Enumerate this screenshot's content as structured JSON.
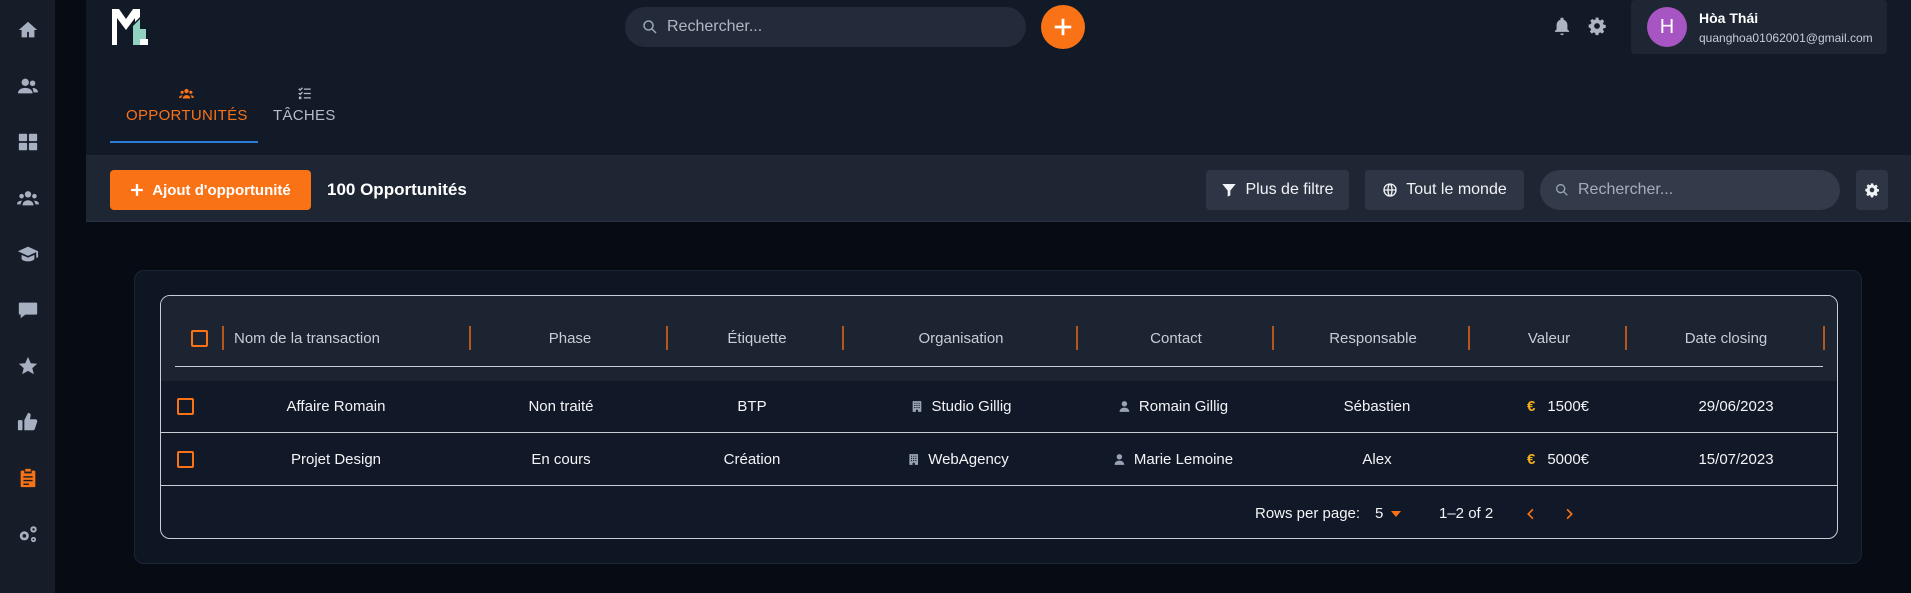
{
  "sidebar": {
    "items": [
      {
        "icon": "home-icon"
      },
      {
        "icon": "contacts-icon"
      },
      {
        "icon": "dashboard-icon"
      },
      {
        "icon": "team-icon"
      },
      {
        "icon": "graduation-cap-icon"
      },
      {
        "icon": "chat-icon"
      },
      {
        "icon": "star-icon"
      },
      {
        "icon": "thumbs-up-icon"
      },
      {
        "icon": "clipboard-icon",
        "active": true
      },
      {
        "icon": "cogs-icon"
      }
    ]
  },
  "header": {
    "search_placeholder": "Rechercher...",
    "user": {
      "initial": "H",
      "name": "Hòa Thái",
      "email": "quanghoa01062001@gmail.com"
    }
  },
  "tabs": [
    {
      "label": "OPPORTUNITÉS",
      "icon": "users-icon",
      "active": true
    },
    {
      "label": "TÂCHES",
      "icon": "checklist-icon",
      "active": false
    }
  ],
  "toolbar": {
    "add_label": "Ajout d'opportunité",
    "count_label": "100 Opportunités",
    "filter_label": "Plus de filtre",
    "scope_label": "Tout le monde",
    "search_placeholder": "Rechercher..."
  },
  "table": {
    "columns": [
      "Nom de la transaction",
      "Phase",
      "Étiquette",
      "Organisation",
      "Contact",
      "Responsable",
      "Valeur",
      "Date closing"
    ],
    "rows": [
      {
        "name": "Affaire Romain",
        "phase": "Non traité",
        "tag": "BTP",
        "org": "Studio Gillig",
        "contact": "Romain Gillig",
        "owner": "Sébastien",
        "currency": "€",
        "value": "1500€",
        "date": "29/06/2023"
      },
      {
        "name": "Projet Design",
        "phase": "En cours",
        "tag": "Création",
        "org": "WebAgency",
        "contact": "Marie Lemoine",
        "owner": "Alex",
        "currency": "€",
        "value": "5000€",
        "date": "15/07/2023"
      }
    ]
  },
  "pagination": {
    "rows_per_page_label": "Rows per page:",
    "rows_per_page": "5",
    "range": "1–2 of 2"
  },
  "colors": {
    "accent": "#f97316",
    "tab_indicator": "#2e7bd9",
    "avatar": "#a855c4",
    "currency": "#f2b01e"
  }
}
